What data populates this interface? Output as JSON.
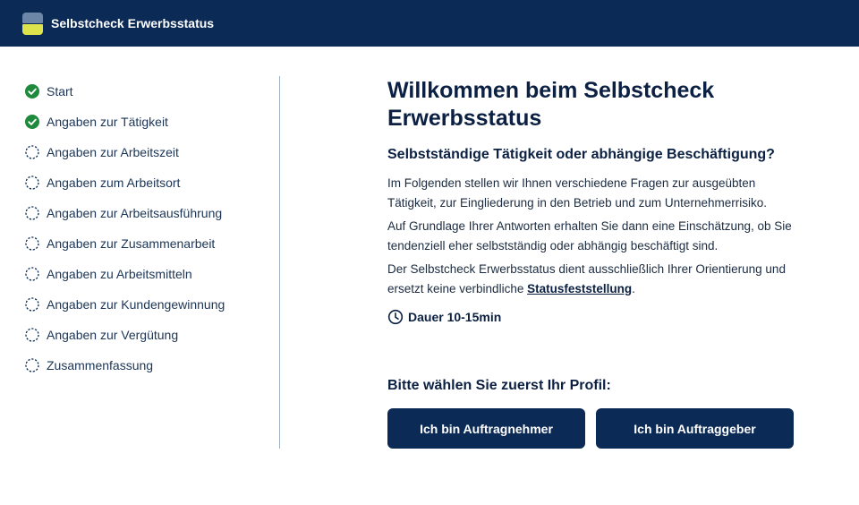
{
  "header": {
    "title": "Selbstcheck Erwerbsstatus"
  },
  "sidebar": {
    "items": [
      {
        "label": "Start",
        "status": "done"
      },
      {
        "label": "Angaben zur Tätigkeit",
        "status": "done"
      },
      {
        "label": "Angaben zur Arbeitszeit",
        "status": "pending"
      },
      {
        "label": "Angaben zum Arbeitsort",
        "status": "pending"
      },
      {
        "label": "Angaben zur Arbeitsausführung",
        "status": "pending"
      },
      {
        "label": "Angaben zur Zusammenarbeit",
        "status": "pending"
      },
      {
        "label": "Angaben zu Arbeitsmitteln",
        "status": "pending"
      },
      {
        "label": "Angaben zur Kundengewinnung",
        "status": "pending"
      },
      {
        "label": "Angaben zur Vergütung",
        "status": "pending"
      },
      {
        "label": "Zusammenfassung",
        "status": "pending"
      }
    ]
  },
  "main": {
    "headline": "Willkommen beim Selbstcheck Erwerbsstatus",
    "subheadline": "Selbstständige Tätigkeit oder abhängige Beschäftigung?",
    "para1": "Im Folgenden stellen wir Ihnen verschiedene Fragen zur ausgeübten Tätigkeit, zur Eingliederung in den Betrieb und zum Unternehmerrisiko.",
    "para2": "Auf Grundlage Ihrer Antworten erhalten Sie dann eine Einschätzung, ob Sie tendenziell eher selbstständig oder abhängig beschäftigt sind.",
    "para3_before": "Der Selbstcheck Erwerbsstatus dient ausschließlich Ihrer Orientierung und ersetzt keine verbindliche ",
    "para3_link": "Statusfeststellung",
    "para3_after": ".",
    "duration": "Dauer 10-15min",
    "profile_prompt": "Bitte wählen Sie zuerst Ihr Profil:",
    "button_contractor": "Ich bin Auftragnehmer",
    "button_client": "Ich bin Auftraggeber"
  },
  "colors": {
    "header_bg": "#0b2a55",
    "done_green": "#1e8a3c",
    "button_bg": "#0b2a55",
    "logo_top": "#6b86a6",
    "logo_bottom": "#dde34a"
  },
  "icons": {
    "done": "check-circle-icon",
    "pending": "dashed-circle-icon",
    "duration": "clock-icon"
  }
}
